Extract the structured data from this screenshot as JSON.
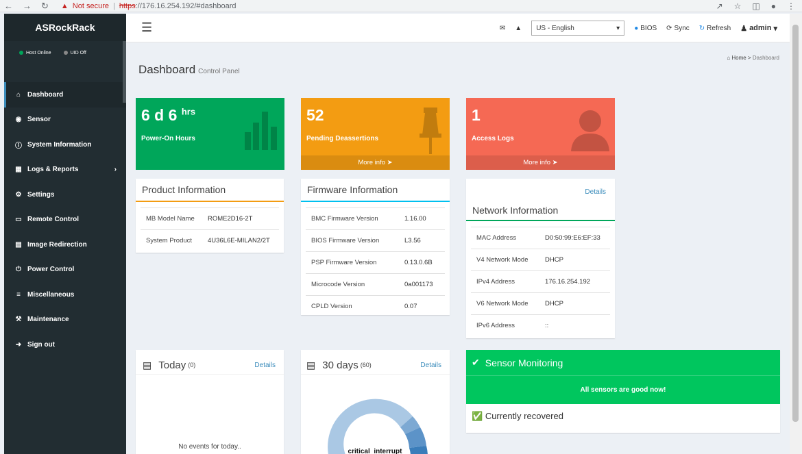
{
  "browser": {
    "not_secure": "Not secure",
    "url_scheme": "https",
    "url_rest": "://176.16.254.192/#dashboard"
  },
  "sidebar": {
    "brand": "ASRockRack",
    "host_status": "Host Online",
    "uid_status": "UID Off",
    "items": [
      {
        "label": "Dashboard",
        "icon": "dashboard-icon"
      },
      {
        "label": "Sensor",
        "icon": "sensor-icon"
      },
      {
        "label": "System Information",
        "icon": "info-icon"
      },
      {
        "label": "Logs & Reports",
        "icon": "chart-icon"
      },
      {
        "label": "Settings",
        "icon": "gear-icon"
      },
      {
        "label": "Remote Control",
        "icon": "monitor-icon"
      },
      {
        "label": "Image Redirection",
        "icon": "drive-icon"
      },
      {
        "label": "Power Control",
        "icon": "power-icon"
      },
      {
        "label": "Miscellaneous",
        "icon": "list-icon"
      },
      {
        "label": "Maintenance",
        "icon": "wrench-icon"
      },
      {
        "label": "Sign out",
        "icon": "signout-icon"
      }
    ]
  },
  "header": {
    "language": "US - English",
    "bios": "BIOS",
    "sync": "Sync",
    "refresh": "Refresh",
    "user": "admin"
  },
  "page": {
    "title": "Dashboard",
    "subtitle": "Control Panel",
    "breadcrumb_home": "Home",
    "breadcrumb_current": "Dashboard"
  },
  "tiles": {
    "power_on": {
      "value": "6 d 6",
      "unit": "hrs",
      "label": "Power-On Hours",
      "color": "#00a65a"
    },
    "pending": {
      "value": "52",
      "label": "Pending Deassertions",
      "more": "More info",
      "color": "#f39c12"
    },
    "access": {
      "value": "1",
      "label": "Access Logs",
      "more": "More info",
      "color": "#f56954"
    }
  },
  "product": {
    "title": "Product Information",
    "rows": [
      {
        "k": "MB Model Name",
        "v": "ROME2D16-2T"
      },
      {
        "k": "System Product",
        "v": "4U36L6E-MILAN2/2T"
      }
    ]
  },
  "firmware": {
    "title": "Firmware Information",
    "rows": [
      {
        "k": "BMC Firmware Version",
        "v": "1.16.00"
      },
      {
        "k": "BIOS Firmware Version",
        "v": "L3.56"
      },
      {
        "k": "PSP Firmware Version",
        "v": "0.13.0.6B"
      },
      {
        "k": "Microcode Version",
        "v": "0a001173"
      },
      {
        "k": "CPLD Version",
        "v": "0.07"
      }
    ]
  },
  "network": {
    "details": "Details",
    "title": "Network Information",
    "rows": [
      {
        "k": "MAC Address",
        "v": "D0:50:99:E6:EF:33"
      },
      {
        "k": "V4 Network Mode",
        "v": "DHCP"
      },
      {
        "k": "IPv4 Address",
        "v": "176.16.254.192"
      },
      {
        "k": "V6 Network Mode",
        "v": "DHCP"
      },
      {
        "k": "IPv6 Address",
        "v": "::"
      }
    ]
  },
  "today": {
    "title": "Today",
    "count": "(0)",
    "details": "Details",
    "empty": "No events for today.."
  },
  "days30": {
    "title": "30 days",
    "count": "(60)",
    "details": "Details",
    "chart_label": "critical_interrupt"
  },
  "sensor": {
    "title": "Sensor Monitoring",
    "status": "All sensors are good now!",
    "recovered": "Currently recovered"
  }
}
